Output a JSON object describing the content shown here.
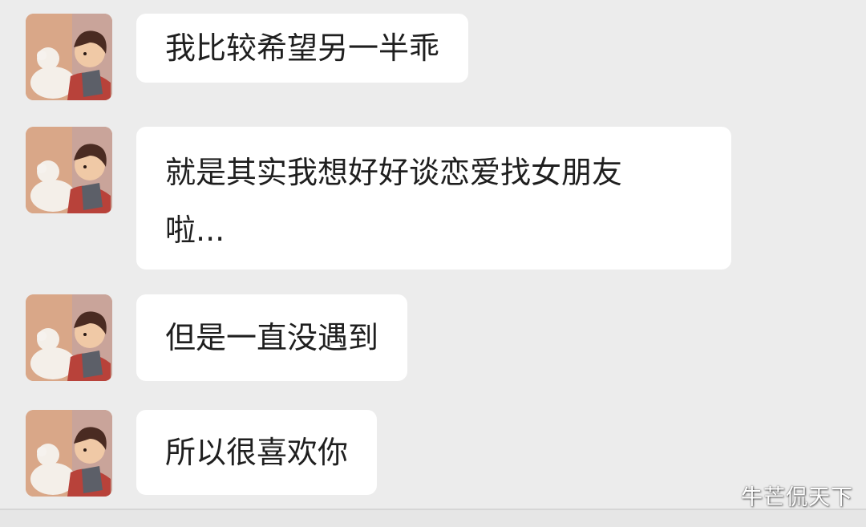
{
  "chat": {
    "messages": [
      {
        "text": "我比较希望另一半乖"
      },
      {
        "lines": [
          "就是其实我想好好谈恋爱找女朋友",
          "啦..."
        ]
      },
      {
        "text": "但是一直没遇到"
      },
      {
        "text": "所以很喜欢你"
      }
    ]
  },
  "avatar": {
    "icon": "avatar-illustration",
    "bg_color": "#d9a788"
  },
  "watermark": {
    "text": "牛芒侃天下"
  },
  "colors": {
    "background": "#ececec",
    "bubble": "#ffffff",
    "text": "#1f1f1f"
  }
}
